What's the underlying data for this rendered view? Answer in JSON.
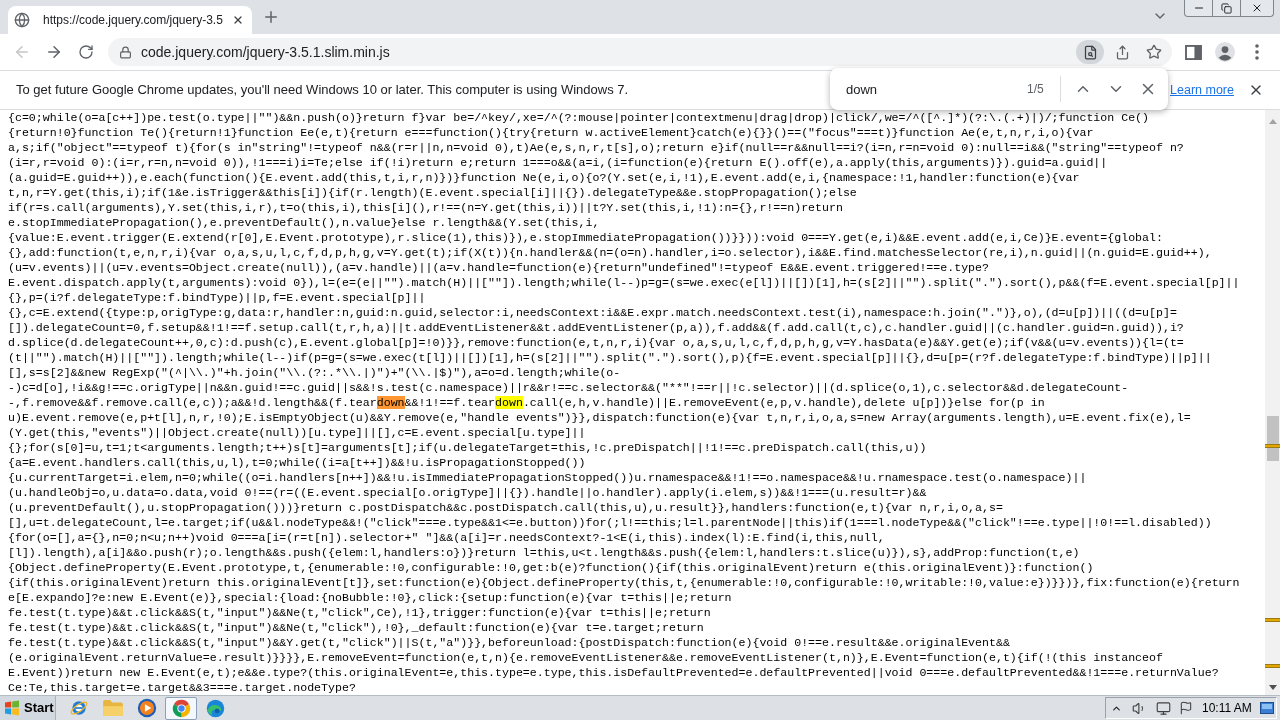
{
  "browser": {
    "tabs": [
      {
        "title": "https://code.jquery.com/jquery-3.5",
        "selected": true
      }
    ],
    "back": {
      "disabled": true
    },
    "forward": {
      "disabled": false
    },
    "address_bar": {
      "url": "code.jquery.com/jquery-3.5.1.slim.min.js",
      "find_active": true
    }
  },
  "infobar": {
    "message": "To get future Google Chrome updates, you'll need Windows 10 or later. This computer is using Windows 7.",
    "link": "Learn more"
  },
  "find_bar": {
    "query": "down",
    "count": "1/5"
  },
  "code": {
    "lines": [
      [
        {
          "kind": "text",
          "text": "{c=0;while(o=a[c++])pe.test(o.type||\"\")&&n.push(o)}return f}var be=/^key/,xe=/^(?:mouse|pointer|contextmenu|drag|drop)|click/,we=/^([^.]*)(?:\\.(.+)|)/;function Ce()"
        }
      ],
      [
        {
          "kind": "text",
          "text": "{return!0}function Te(){return!1}function Ee(e,t){return e===function(){try{return w.activeElement}catch(e){}}()==(\"focus\"===t)}function Ae(e,t,n,r,i,o){var"
        }
      ],
      [
        {
          "kind": "text",
          "text": "a,s;if(\"object\"==typeof t){for(s in\"string\"!=typeof n&&(r=r||n,n=void 0),t)Ae(e,s,n,r,t[s],o);return e}if(null==r&&null==i?(i=n,r=n=void 0):null==i&&(\"string\"==typeof n?"
        }
      ],
      [
        {
          "kind": "text",
          "text": "(i=r,r=void 0):(i=r,r=n,n=void 0)),!1===i)i=Te;else if(!i)return e;return 1===o&&(a=i,(i=function(e){return E().off(e),a.apply(this,arguments)}).guid=a.guid||"
        }
      ],
      [
        {
          "kind": "text",
          "text": "(a.guid=E.guid++)),e.each(function(){E.event.add(this,t,i,r,n)})}function Ne(e,i,o){o?(Y.set(e,i,!1),E.event.add(e,i,{namespace:!1,handler:function(e){var"
        }
      ],
      [
        {
          "kind": "text",
          "text": "t,n,r=Y.get(this,i);if(1&e.isTrigger&&this[i]){if(r.length)(E.event.special[i]||{}).delegateType&&e.stopPropagation();else"
        }
      ],
      [
        {
          "kind": "text",
          "text": "if(r=s.call(arguments),Y.set(this,i,r),t=o(this,i),this[i](),r!==(n=Y.get(this,i))||t?Y.set(this,i,!1):n={},r!==n)return"
        }
      ],
      [
        {
          "kind": "text",
          "text": "e.stopImmediatePropagation(),e.preventDefault(),n.value}else r.length&&(Y.set(this,i,"
        }
      ],
      [
        {
          "kind": "text",
          "text": "{value:E.event.trigger(E.extend(r[0],E.Event.prototype),r.slice(1),this)}),e.stopImmediatePropagation())}})):void 0===Y.get(e,i)&&E.event.add(e,i,Ce)}E.event={global:"
        }
      ],
      [
        {
          "kind": "text",
          "text": "{},add:function(t,e,n,r,i){var o,a,s,u,l,c,f,d,p,h,g,v=Y.get(t);if(X(t)){n.handler&&(n=(o=n).handler,i=o.selector),i&&E.find.matchesSelector(re,i),n.guid||(n.guid=E.guid++),"
        }
      ],
      [
        {
          "kind": "text",
          "text": "(u=v.events)||(u=v.events=Object.create(null)),(a=v.handle)||(a=v.handle=function(e){return\"undefined\"!=typeof E&&E.event.triggered!==e.type?"
        }
      ],
      [
        {
          "kind": "text",
          "text": "E.event.dispatch.apply(t,arguments):void 0}),l=(e=(e||\"\").match(H)||[\"\"]).length;while(l--)p=g=(s=we.exec(e[l])||[])[1],h=(s[2]||\"\").split(\".\").sort(),p&&(f=E.event.special[p]||"
        }
      ],
      [
        {
          "kind": "text",
          "text": "{},p=(i?f.delegateType:f.bindType)||p,f=E.event.special[p]||"
        }
      ],
      [
        {
          "kind": "text",
          "text": "{},c=E.extend({type:p,origType:g,data:r,handler:n,guid:n.guid,selector:i,needsContext:i&&E.expr.match.needsContext.test(i),namespace:h.join(\".\")},o),(d=u[p])||((d=u[p]="
        }
      ],
      [
        {
          "kind": "text",
          "text": "[]).delegateCount=0,f.setup&&!1!==f.setup.call(t,r,h,a)||t.addEventListener&&t.addEventListener(p,a)),f.add&&(f.add.call(t,c),c.handler.guid||(c.handler.guid=n.guid)),i?"
        }
      ],
      [
        {
          "kind": "text",
          "text": "d.splice(d.delegateCount++,0,c):d.push(c),E.event.global[p]=!0)}},remove:function(e,t,n,r,i){var o,a,s,u,l,c,f,d,p,h,g,v=Y.hasData(e)&&Y.get(e);if(v&&(u=v.events)){l=(t="
        }
      ],
      [
        {
          "kind": "text",
          "text": "(t||\"\").match(H)||[\"\"]).length;while(l--)if(p=g=(s=we.exec(t[l])||[])[1],h=(s[2]||\"\").split(\".\").sort(),p){f=E.event.special[p]||{},d=u[p=(r?f.delegateType:f.bindType)||p]||"
        }
      ],
      [
        {
          "kind": "text",
          "text": "[],s=s[2]&&new RegExp(\"(^|\\\\.)\"+h.join(\"\\\\.(?:.*\\\\.|)\")+\"(\\\\.|$)\"),a=o=d.length;while(o-"
        }
      ],
      [
        {
          "kind": "text",
          "text": "-)c=d[o],!i&&g!==c.origType||n&&n.guid!==c.guid||s&&!s.test(c.namespace)||r&&r!==c.selector&&(\"**\"!==r||!c.selector)||(d.splice(o,1),c.selector&&d.delegateCount-"
        }
      ],
      [
        {
          "kind": "text",
          "text": "-,f.remove&&f.remove.call(e,c));a&&!d.length&&(f.tear"
        },
        {
          "kind": "match",
          "text": "down",
          "current": true
        },
        {
          "kind": "text",
          "text": "&&!1!==f.tear"
        },
        {
          "kind": "match",
          "text": "down",
          "current": false
        },
        {
          "kind": "text",
          "text": ".call(e,h,v.handle)||E.removeEvent(e,p,v.handle),delete u[p])}else for(p in"
        }
      ],
      [
        {
          "kind": "text",
          "text": "u)E.event.remove(e,p+t[l],n,r,!0);E.isEmptyObject(u)&&Y.remove(e,\"handle events\")}},dispatch:function(e){var t,n,r,i,o,a,s=new Array(arguments.length),u=E.event.fix(e),l="
        }
      ],
      [
        {
          "kind": "text",
          "text": "(Y.get(this,\"events\")||Object.create(null))[u.type]||[],c=E.event.special[u.type]||"
        }
      ],
      [
        {
          "kind": "text",
          "text": "{};for(s[0]=u,t=1;t<arguments.length;t++)s[t]=arguments[t];if(u.delegateTarget=this,!c.preDispatch||!1!==c.preDispatch.call(this,u))"
        }
      ],
      [
        {
          "kind": "text",
          "text": "{a=E.event.handlers.call(this,u,l),t=0;while((i=a[t++])&&!u.isPropagationStopped())"
        }
      ],
      [
        {
          "kind": "text",
          "text": "{u.currentTarget=i.elem,n=0;while((o=i.handlers[n++])&&!u.isImmediatePropagationStopped())u.rnamespace&&!1!==o.namespace&&!u.rnamespace.test(o.namespace)||"
        }
      ],
      [
        {
          "kind": "text",
          "text": "(u.handleObj=o,u.data=o.data,void 0!==(r=((E.event.special[o.origType]||{}).handle||o.handler).apply(i.elem,s))&&!1===(u.result=r)&&"
        }
      ],
      [
        {
          "kind": "text",
          "text": "(u.preventDefault(),u.stopPropagation()))}return c.postDispatch&&c.postDispatch.call(this,u),u.result}},handlers:function(e,t){var n,r,i,o,a,s="
        }
      ],
      [
        {
          "kind": "text",
          "text": "[],u=t.delegateCount,l=e.target;if(u&&l.nodeType&&!(\"click\"===e.type&&1<=e.button))for(;l!==this;l=l.parentNode||this)if(1===l.nodeType&&(\"click\"!==e.type||!0!==l.disabled))"
        }
      ],
      [
        {
          "kind": "text",
          "text": "{for(o=[],a={},n=0;n<u;n++)void 0===a[i=(r=t[n]).selector+\" \"]&&(a[i]=r.needsContext?-1<E(i,this).index(l):E.find(i,this,null,"
        }
      ],
      [
        {
          "kind": "text",
          "text": "[l]).length),a[i]&&o.push(r);o.length&&s.push({elem:l,handlers:o})}return l=this,u<t.length&&s.push({elem:l,handlers:t.slice(u)}),s},addProp:function(t,e)"
        }
      ],
      [
        {
          "kind": "text",
          "text": "{Object.defineProperty(E.Event.prototype,t,{enumerable:!0,configurable:!0,get:b(e)?function(){if(this.originalEvent)return e(this.originalEvent)}:function()"
        }
      ],
      [
        {
          "kind": "text",
          "text": "{if(this.originalEvent)return this.originalEvent[t]},set:function(e){Object.defineProperty(this,t,{enumerable:!0,configurable:!0,writable:!0,value:e})}})},fix:function(e){return"
        }
      ],
      [
        {
          "kind": "text",
          "text": "e[E.expando]?e:new E.Event(e)},special:{load:{noBubble:!0},click:{setup:function(e){var t=this||e;return"
        }
      ],
      [
        {
          "kind": "text",
          "text": "fe.test(t.type)&&t.click&&S(t,\"input\")&&Ne(t,\"click\",Ce),!1},trigger:function(e){var t=this||e;return"
        }
      ],
      [
        {
          "kind": "text",
          "text": "fe.test(t.type)&&t.click&&S(t,\"input\")&&Ne(t,\"click\"),!0},_default:function(e){var t=e.target;return"
        }
      ],
      [
        {
          "kind": "text",
          "text": "fe.test(t.type)&&t.click&&S(t,\"input\")&&Y.get(t,\"click\")||S(t,\"a\")}},beforeunload:{postDispatch:function(e){void 0!==e.result&&e.originalEvent&&"
        }
      ],
      [
        {
          "kind": "text",
          "text": "(e.originalEvent.returnValue=e.result)}}}},E.removeEvent=function(e,t,n){e.removeEventListener&&e.removeEventListener(t,n)},E.Event=function(e,t){if(!(this instanceof"
        }
      ],
      [
        {
          "kind": "text",
          "text": "E.Event))return new E.Event(e,t);e&&e.type?(this.originalEvent=e,this.type=e.type,this.isDefaultPrevented=e.defaultPrevented||void 0===e.defaultPrevented&&!1===e.returnValue?"
        }
      ],
      [
        {
          "kind": "text",
          "text": "Ce:Te,this.target=e.target&&3===e.target.nodeType?"
        }
      ]
    ]
  },
  "taskbar": {
    "start": "Start",
    "apps": [
      {
        "selected": false
      },
      {
        "selected": false
      },
      {
        "selected": false
      },
      {
        "selected": true
      },
      {
        "selected": false
      }
    ],
    "clock": "10:11 AM"
  }
}
